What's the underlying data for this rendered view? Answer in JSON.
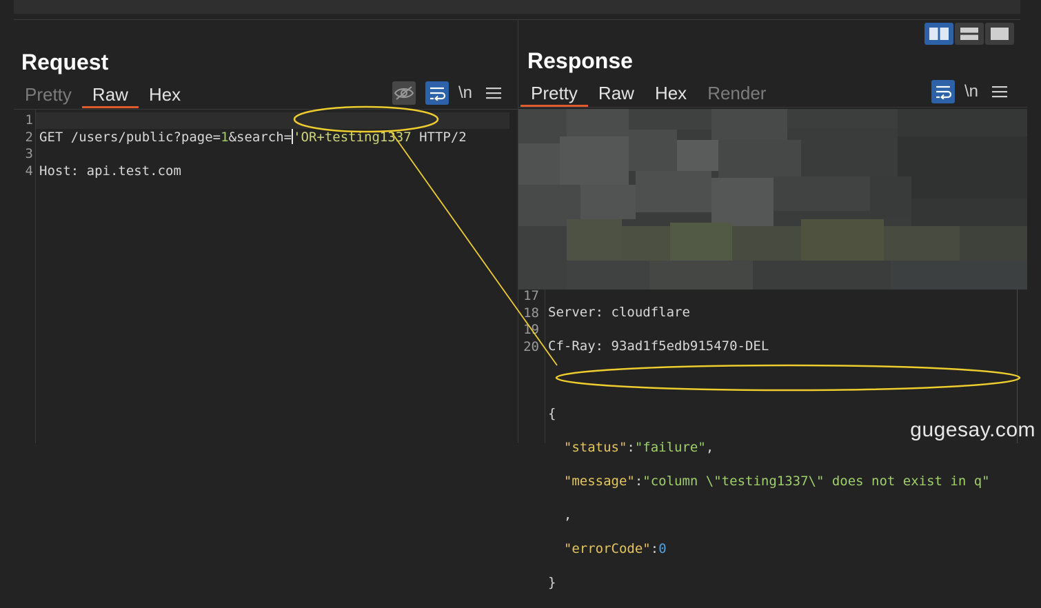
{
  "request": {
    "title": "Request",
    "tabs": [
      "Pretty",
      "Raw",
      "Hex"
    ],
    "active_tab": "Raw",
    "line_numbers": [
      "1",
      "2",
      "3",
      "4"
    ],
    "line1": {
      "method": "GET",
      "path": " /users/public?page=",
      "page_value": "1",
      "amp": "&search=",
      "search_value": "'OR+testing1337",
      "protocol": " HTTP/2"
    },
    "line2": {
      "header_key": "Host:",
      "header_value": " api.test.com"
    }
  },
  "response": {
    "title": "Response",
    "tabs": [
      "Pretty",
      "Raw",
      "Hex",
      "Render"
    ],
    "active_tab": "Pretty",
    "line_numbers": [
      "17",
      "18",
      "19",
      "20"
    ],
    "headers": [
      {
        "key": "Server:",
        "value": " cloudflare"
      },
      {
        "key": "Cf-Ray:",
        "value": " 93ad1f5edb915470-DEL"
      }
    ],
    "body": {
      "open_brace": "{",
      "status_key": "\"status\"",
      "status_value": "\"failure\"",
      "message_key": "\"message\"",
      "message_value": "\"column \\\"testing1337\\\" does not exist in q\"",
      "comma": ",",
      "error_code_key": "\"errorCode\"",
      "error_code_value": "0",
      "close_brace": "}"
    }
  },
  "toolbar": {
    "newline_label": "\\n"
  },
  "watermark": "gugesay.com",
  "colors": {
    "accent_blue": "#2e62a8",
    "tab_underline": "#e05a2b",
    "annotation": "#f0cd2e"
  }
}
